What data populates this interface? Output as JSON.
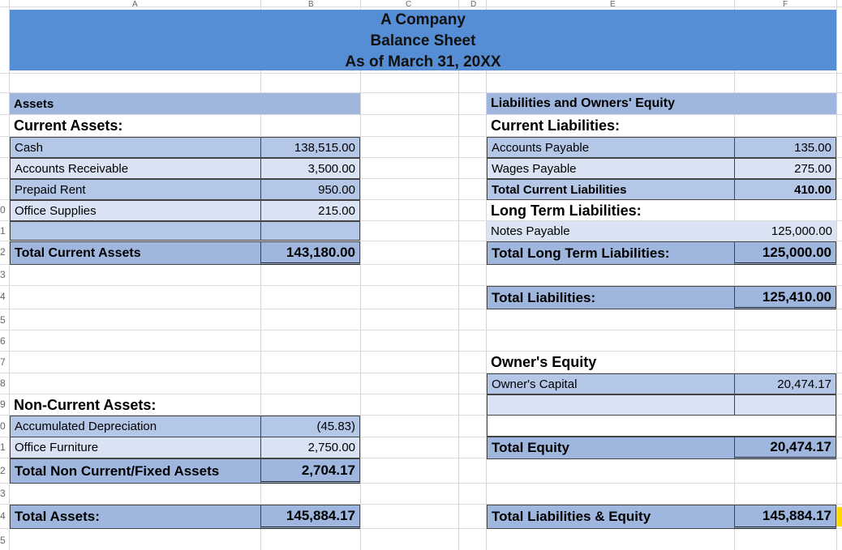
{
  "header": {
    "company": "A Company",
    "report": "Balance Sheet",
    "date": "As of March 31, 20XX"
  },
  "column_letters": [
    "A",
    "B",
    "C",
    "D",
    "E",
    "F"
  ],
  "row_numbers_partial": [
    "0",
    "1",
    "2",
    "3",
    "4",
    "5",
    "6",
    "7",
    "8",
    "9",
    "0",
    "1",
    "2",
    "3",
    "4",
    "5"
  ],
  "assets": {
    "heading": "Assets",
    "current_heading": "Current Assets:",
    "current_items": [
      {
        "label": "Cash",
        "value": "138,515.00"
      },
      {
        "label": "Accounts Receivable",
        "value": "3,500.00"
      },
      {
        "label": "Prepaid Rent",
        "value": "950.00"
      },
      {
        "label": "Office Supplies",
        "value": "215.00"
      }
    ],
    "total_current_label": "Total Current Assets",
    "total_current_value": "143,180.00",
    "noncurrent_heading": "Non-Current Assets:",
    "noncurrent_items": [
      {
        "label": "Accumulated Depreciation",
        "value": "(45.83)"
      },
      {
        "label": "Office Furniture",
        "value": "2,750.00"
      }
    ],
    "total_noncurrent_label": "Total Non Current/Fixed Assets",
    "total_noncurrent_value": "2,704.17",
    "total_assets_label": "Total Assets:",
    "total_assets_value": "145,884.17"
  },
  "liabilities": {
    "heading": "Liabilities and Owners' Equity",
    "current_heading": "Current Liabilities:",
    "current_items": [
      {
        "label": "Accounts Payable",
        "value": "135.00"
      },
      {
        "label": "Wages Payable",
        "value": "275.00"
      }
    ],
    "total_current_label": "Total Current Liabilities",
    "total_current_value": "410.00",
    "longterm_heading": "Long Term Liabilities:",
    "longterm_items": [
      {
        "label": "Notes Payable",
        "value": "125,000.00"
      }
    ],
    "total_longterm_label": "Total Long Term Liabilities:",
    "total_longterm_value": "125,000.00",
    "total_liabilities_label": "Total Liabilities:",
    "total_liabilities_value": "125,410.00"
  },
  "equity": {
    "heading": "Owner's Equity",
    "items": [
      {
        "label": "Owner's Capital",
        "value": "20,474.17"
      }
    ],
    "total_label": "Total Equity",
    "total_value": "20,474.17",
    "total_le_label": "Total Liabilities & Equity",
    "total_le_value": "145,884.17"
  }
}
